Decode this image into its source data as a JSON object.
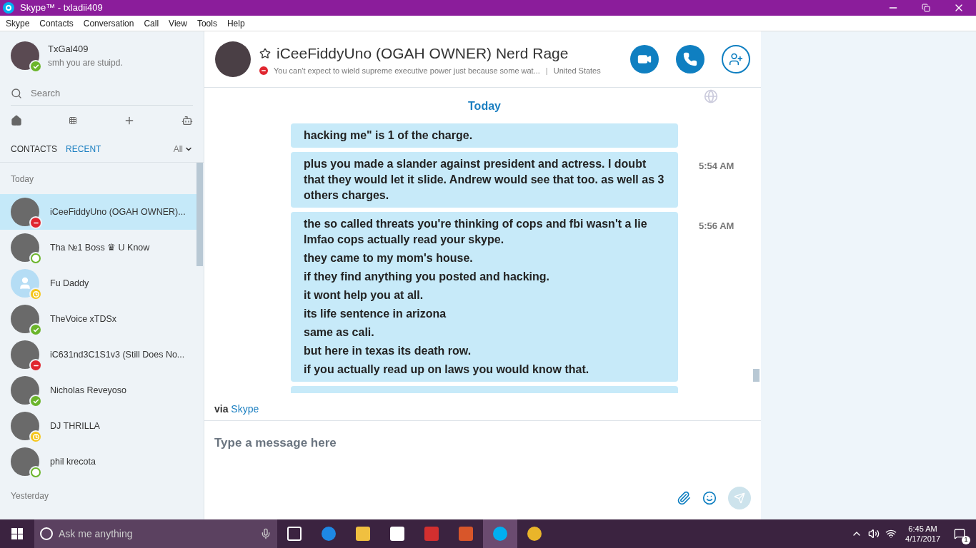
{
  "window": {
    "title": "Skype™ - txladii409"
  },
  "menu": [
    "Skype",
    "Contacts",
    "Conversation",
    "Call",
    "View",
    "Tools",
    "Help"
  ],
  "profile": {
    "name": "TxGal409",
    "mood": "smh you are stuipd.",
    "kind": "online",
    "color": "#6bb52b"
  },
  "search": {
    "placeholder": "Search"
  },
  "list_tabs": [
    {
      "label": "CONTACTS",
      "selected": false
    },
    {
      "label": "RECENT",
      "selected": true
    }
  ],
  "filter": "All",
  "groups": [
    {
      "label": "Today",
      "contacts": [
        {
          "name": "iCeeFiddyUno (OGAH OWNER)...",
          "kind": "busy",
          "color": "#e0262f",
          "photo": true,
          "selected": true
        },
        {
          "name": "Tha №1 Boss ♛ U Know",
          "kind": "offline",
          "color": "#6bb52b",
          "photo": true,
          "selected": false
        },
        {
          "name": "Fu Daddy",
          "kind": "away",
          "color": "#f5c518",
          "photo": false,
          "selected": false
        },
        {
          "name": "TheVoice xTDSx",
          "kind": "online",
          "color": "#6bb52b",
          "photo": true,
          "selected": false
        },
        {
          "name": "iC631nd3C1S1v3 (Still Does No...",
          "kind": "busy",
          "color": "#e0262f",
          "photo": true,
          "selected": false
        },
        {
          "name": "Nicholas Reveyoso",
          "kind": "online",
          "color": "#6bb52b",
          "photo": true,
          "selected": false
        },
        {
          "name": "DJ THRILLA",
          "kind": "away",
          "color": "#f5c518",
          "photo": true,
          "selected": false
        },
        {
          "name": "phil krecota",
          "kind": "offline",
          "color": "#6bb52b",
          "photo": true,
          "selected": false
        }
      ]
    },
    {
      "label": "Yesterday"
    }
  ],
  "conversation": {
    "name": "iCeeFiddyUno (OGAH OWNER) Nerd Rage",
    "kind": "busy",
    "color": "#e0262f",
    "mood": "You can't expect to wield supreme executive power just because some wat...",
    "separator": "|",
    "location": "United States"
  },
  "day_label": "Today",
  "messages": [
    {
      "lines": [
        "hacking me\" is 1 of the charge."
      ]
    },
    {
      "time": "5:54 AM",
      "lines": [
        "plus you made a slander against president and actress. I doubt that they would let it slide. Andrew would see that too. as well as 3 others charges."
      ]
    },
    {
      "time": "5:56 AM",
      "lines": [
        "the so called threats you're thinking of cops and fbi wasn't a lie lmfao cops actually read your skype.",
        "they came to my mom's house.",
        "if they find anything you posted and hacking.",
        "it wont help you at all.",
        "its life sentence in arizona",
        "same as cali.",
        "but here in texas its death row.",
        "if you actually read up on laws you would know that."
      ]
    }
  ],
  "via": {
    "prefix": "via",
    "link": "Skype"
  },
  "composer": {
    "placeholder": "Type a message here"
  },
  "taskbar": {
    "search_placeholder": "Ask me anything",
    "time": "6:45 AM",
    "date": "4/17/2017",
    "notifications": "1"
  }
}
